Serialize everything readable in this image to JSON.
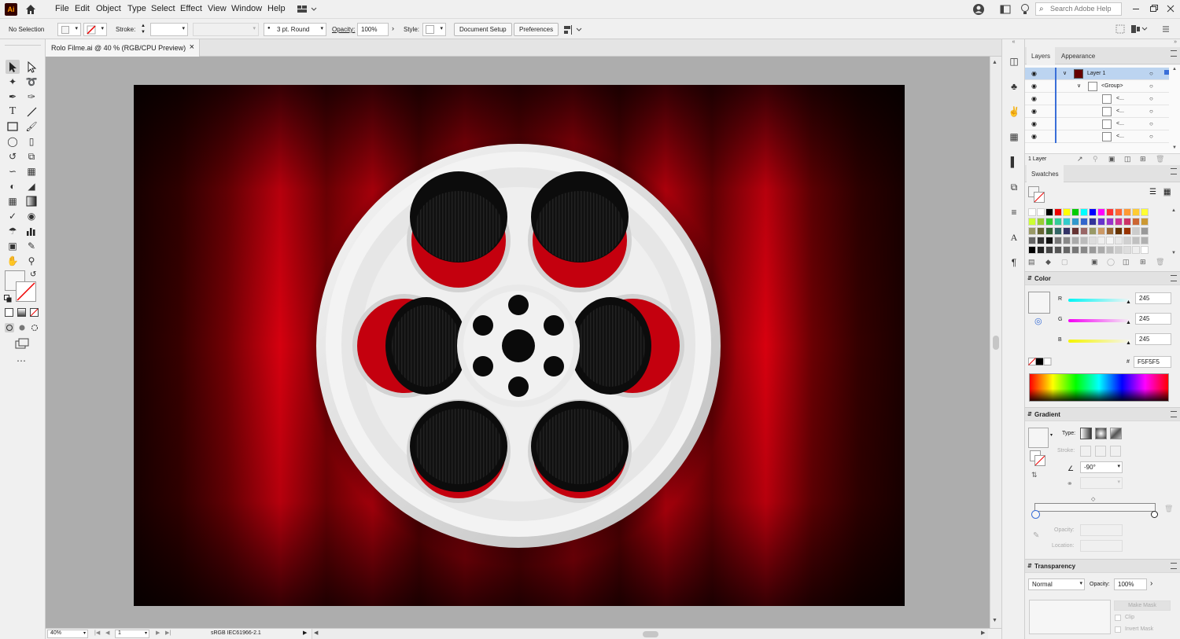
{
  "menubar": {
    "app_logo": "Ai",
    "menus": [
      "File",
      "Edit",
      "Object",
      "Type",
      "Select",
      "Effect",
      "View",
      "Window",
      "Help"
    ],
    "search_placeholder": "Search Adobe Help"
  },
  "control_bar": {
    "selection": "No Selection",
    "stroke_label": "Stroke:",
    "brush": "3 pt. Round",
    "opacity_label": "Opacity:",
    "opacity_value": "100%",
    "style_label": "Style:",
    "document_setup": "Document Setup",
    "preferences": "Preferences"
  },
  "document": {
    "tab_title": "Rolo Filme.ai @ 40 % (RGB/CPU Preview)",
    "close_glyph": "×"
  },
  "status_bar": {
    "zoom": "40%",
    "artboard": "1",
    "color_profile": "sRGB IEC61966-2.1"
  },
  "layers_panel": {
    "tabs": [
      "Layers",
      "Appearance"
    ],
    "rows": [
      {
        "name": "Layer 1"
      },
      {
        "name": "<Group>"
      },
      {
        "name": "<..."
      },
      {
        "name": "<..."
      },
      {
        "name": "<..."
      },
      {
        "name": "<..."
      }
    ],
    "footer": "1 Layer"
  },
  "swatches_panel": {
    "title": "Swatches"
  },
  "color_panel": {
    "title": "Color",
    "r_label": "R",
    "r_value": "245",
    "g_label": "G",
    "g_value": "245",
    "b_label": "B",
    "b_value": "245",
    "hex_label": "#",
    "hex_value": "F5F5F5"
  },
  "gradient_panel": {
    "title": "Gradient",
    "type_label": "Type:",
    "stroke_label": "Stroke:",
    "angle_value": "-90°",
    "opacity_label": "Opacity:",
    "location_label": "Location:"
  },
  "transparency_panel": {
    "title": "Transparency",
    "blend_mode": "Normal",
    "opacity_label": "Opacity:",
    "opacity_value": "100%",
    "make_mask": "Make Mask",
    "clip": "Clip",
    "invert_mask": "Invert Mask"
  },
  "colors": {
    "curtain_red": "#cc0010",
    "curtain_dark": "#260000",
    "reel_white": "#f5f5f5",
    "selection_blue": "#bcd4f0"
  }
}
